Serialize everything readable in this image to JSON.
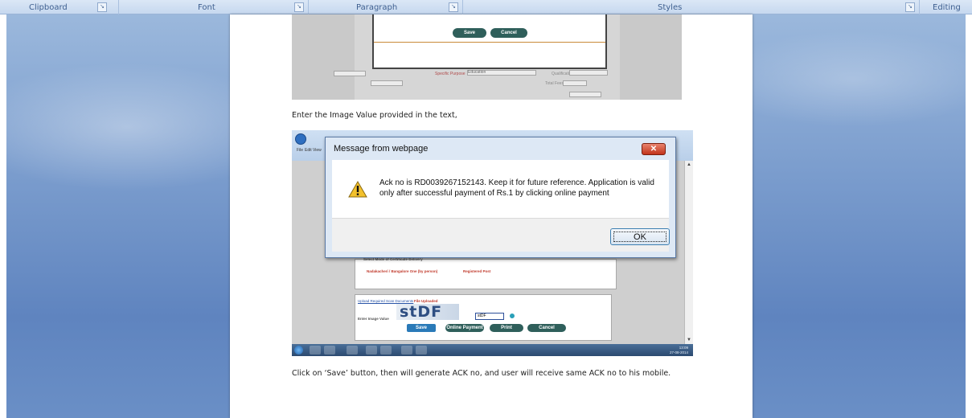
{
  "ribbon": {
    "groups": [
      {
        "label": "Clipboard"
      },
      {
        "label": "Font"
      },
      {
        "label": "Paragraph"
      },
      {
        "label": "Styles"
      },
      {
        "label": "Editing"
      }
    ],
    "launcher_glyph": "↘"
  },
  "document": {
    "instruction_1": "Enter the Image Value provided in the text,",
    "instruction_2": "Click on ‘Save’ button, then will generate ACK no, and user will receive same ACK no to his mobile."
  },
  "screenshot_1": {
    "save_label": "Save",
    "cancel_label": "Cancel",
    "field_purpose": "Specific Purpose",
    "field_purpose_value": "Education",
    "field_total_fees": "Total Fees",
    "field_qualification": "Qualification"
  },
  "screenshot_2": {
    "menu_file": "File",
    "menu_edit": "Edit",
    "menu_view": "View",
    "captcha_text": "stDF",
    "captcha_input_value": "stDF",
    "image_value_label": "Enter Image Value",
    "select_mode_label": "Select Mode of Certificate Delivery",
    "option_1": "Nadakacheri / Bangalore One (by person)",
    "option_2": "Registered Post",
    "upload_link": "Upload Required Scan Documents",
    "upload_status": "File Uploaded",
    "btn_save": "Save",
    "btn_online_payment": "Online Payment",
    "btn_print": "Print",
    "btn_cancel": "Cancel",
    "clock_time": "13:09",
    "clock_date": "27-08-2014"
  },
  "dialog": {
    "title": "Message from webpage",
    "message": "Ack no is RD0039267152143. Keep it for future reference. Application is valid only after successful payment of Rs.1 by clicking online payment",
    "close_glyph": "✕",
    "ok_label": "OK"
  },
  "colors": {
    "workspace": "#7a9ccd",
    "pill": "#2f5f5b",
    "dialog_frame": "#dde8f5",
    "close_button": "#c2341b"
  }
}
